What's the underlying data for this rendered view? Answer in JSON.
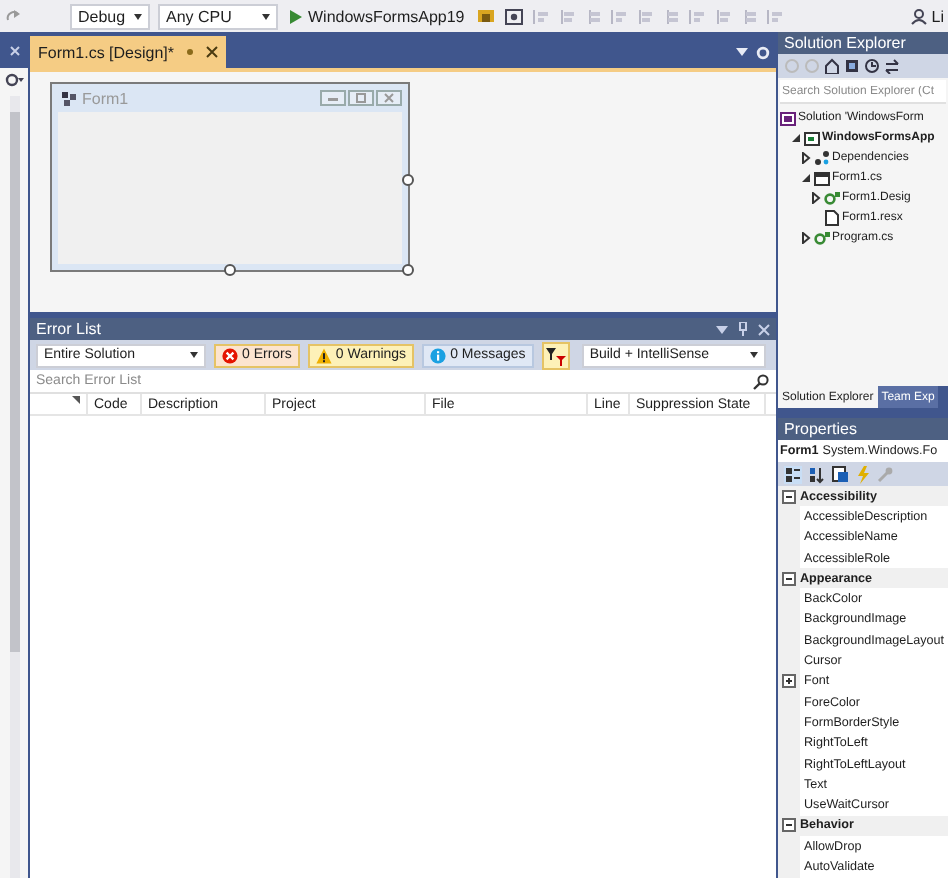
{
  "toolbar": {
    "configuration": "Debug",
    "platform": "Any CPU",
    "start_project": "WindowsFormsApp19",
    "share_label": "Li"
  },
  "document_tabs": [
    {
      "label": "Form1.cs [Design]*",
      "selected": true
    }
  ],
  "designer": {
    "form_title": "Form1"
  },
  "error_list": {
    "title": "Error List",
    "scope": "Entire Solution",
    "filters": [
      {
        "kind": "error",
        "label": "0 Errors",
        "selected": true
      },
      {
        "kind": "warning",
        "label": "0 Warnings",
        "selected": true
      },
      {
        "kind": "message",
        "label": "0 Messages",
        "selected": true
      }
    ],
    "build_filter": "Build + IntelliSense",
    "search": {
      "placeholder": "Search Error List"
    },
    "columns": [
      "Code",
      "Description",
      "Project",
      "File",
      "Line",
      "Suppression State"
    ]
  },
  "solution_explorer": {
    "title": "Solution Explorer",
    "search": {
      "placeholder": "Search Solution Explorer (Ct"
    },
    "tree": [
      {
        "label": "Solution 'WindowsForm",
        "kind": "solution",
        "children": [
          {
            "label": "WindowsFormsApp",
            "kind": "project",
            "expanded": true,
            "children": [
              {
                "label": "Dependencies",
                "kind": "dependencies",
                "expanded": false
              },
              {
                "label": "Form1.cs",
                "kind": "form",
                "expanded": true,
                "children": [
                  {
                    "label": "Form1.Desig",
                    "kind": "csharp",
                    "expanded": false
                  },
                  {
                    "label": "Form1.resx",
                    "kind": "resource"
                  }
                ]
              },
              {
                "label": "Program.cs",
                "kind": "csharp",
                "expanded": false
              }
            ]
          }
        ]
      }
    ]
  },
  "panel_tabs": [
    {
      "label": "Solution Explorer",
      "selected": true
    },
    {
      "label": "Team Exp",
      "selected": false
    }
  ],
  "properties": {
    "title": "Properties",
    "object_name": "Form1",
    "object_type": "System.Windows.Fo",
    "rows": [
      {
        "label": "Accessibility",
        "kind": "category",
        "expanded": true,
        "children": [
          {
            "label": "AccessibleDescription",
            "kind": "property"
          },
          {
            "label": "AccessibleName",
            "kind": "property"
          },
          {
            "label": "AccessibleRole",
            "kind": "property"
          }
        ]
      },
      {
        "label": "Appearance",
        "kind": "category",
        "expanded": true,
        "children": [
          {
            "label": "BackColor",
            "kind": "property"
          },
          {
            "label": "BackgroundImage",
            "kind": "property"
          },
          {
            "label": "BackgroundImageLayout",
            "kind": "property"
          },
          {
            "label": "Cursor",
            "kind": "property"
          },
          {
            "label": "Font",
            "kind": "property",
            "expanded": false
          },
          {
            "label": "ForeColor",
            "kind": "property"
          },
          {
            "label": "FormBorderStyle",
            "kind": "property"
          },
          {
            "label": "RightToLeft",
            "kind": "property"
          },
          {
            "label": "RightToLeftLayout",
            "kind": "property"
          },
          {
            "label": "Text",
            "kind": "property"
          },
          {
            "label": "UseWaitCursor",
            "kind": "property"
          }
        ]
      },
      {
        "label": "Behavior",
        "kind": "category",
        "expanded": true,
        "children": [
          {
            "label": "AllowDrop",
            "kind": "property"
          },
          {
            "label": "AutoValidate",
            "kind": "property"
          }
        ]
      }
    ]
  }
}
